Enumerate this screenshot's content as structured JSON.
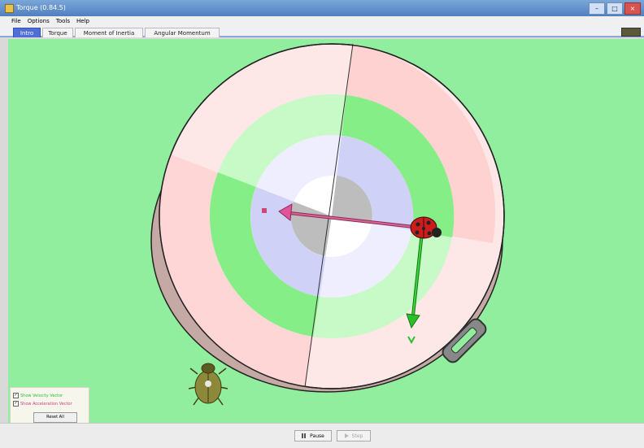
{
  "window": {
    "title": "Torque (0.84.5)"
  },
  "menu": {
    "items": [
      "File",
      "Options",
      "Tools",
      "Help"
    ]
  },
  "tabs": [
    {
      "label": "Intro",
      "active": true
    },
    {
      "label": "Torque",
      "active": false
    },
    {
      "label": "Moment of Inertia",
      "active": false
    },
    {
      "label": "Angular Momentum",
      "active": false
    }
  ],
  "controls": {
    "show_velocity": {
      "label": "Show Velocity Vector",
      "checked": true
    },
    "show_acceleration": {
      "label": "Show Acceleration Vector",
      "checked": true
    },
    "reset_all": "Reset All"
  },
  "bottom": {
    "pause": "Pause",
    "step": "Step"
  },
  "icons": [
    "app-icon",
    "minimize-icon",
    "maximize-icon",
    "close-icon",
    "ladybug-icon",
    "beetle-icon",
    "pause-icon",
    "step-icon"
  ],
  "colors": {
    "background": "#90ee9e",
    "velocity_vector": "#2cbf2c",
    "acceleration_vector": "#c8487a",
    "active_tab": "#4d6fd6"
  }
}
